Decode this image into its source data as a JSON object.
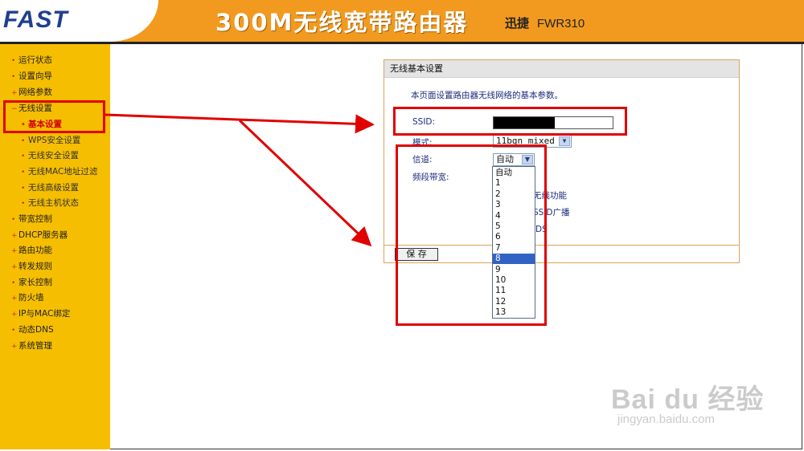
{
  "header": {
    "logo": "FAST",
    "title": "300M无线宽带路由器",
    "brand": "迅捷",
    "model": "FWR310"
  },
  "sidebar": {
    "items": [
      {
        "label": "运行状态"
      },
      {
        "label": "设置向导"
      },
      {
        "label": "网络参数"
      },
      {
        "label": "无线设置"
      },
      {
        "label": "基本设置"
      },
      {
        "label": "WPS安全设置"
      },
      {
        "label": "无线安全设置"
      },
      {
        "label": "无线MAC地址过滤"
      },
      {
        "label": "无线高级设置"
      },
      {
        "label": "无线主机状态"
      },
      {
        "label": "带宽控制"
      },
      {
        "label": "DHCP服务器"
      },
      {
        "label": "路由功能"
      },
      {
        "label": "转发规则"
      },
      {
        "label": "家长控制"
      },
      {
        "label": "防火墙"
      },
      {
        "label": "IP与MAC绑定"
      },
      {
        "label": "动态DNS"
      },
      {
        "label": "系统管理"
      }
    ]
  },
  "panel": {
    "title": "无线基本设置",
    "description": "本页面设置路由器无线网络的基本参数。",
    "ssid_label": "SSID:",
    "mode_label": "模式:",
    "mode_value": "11bgn mixed",
    "channel_label": "信道:",
    "channel_value": "自动",
    "bandwidth_label": "频段带宽:",
    "opt1_text": "无线功能",
    "opt2_text": "SSID广播",
    "opt3_text": "DS",
    "save_label": "保 存"
  },
  "channel_dropdown": {
    "options": [
      "自动",
      "1",
      "2",
      "3",
      "4",
      "5",
      "6",
      "7",
      "8",
      "9",
      "10",
      "11",
      "12",
      "13"
    ],
    "selected": "8"
  },
  "watermark": {
    "brand": "Bai du 经验",
    "url": "jingyan.baidu.com"
  },
  "colors": {
    "header": "#f29a1f",
    "sidebar": "#f6be00",
    "annotation": "#e00000",
    "selected_option": "#3163c5"
  }
}
